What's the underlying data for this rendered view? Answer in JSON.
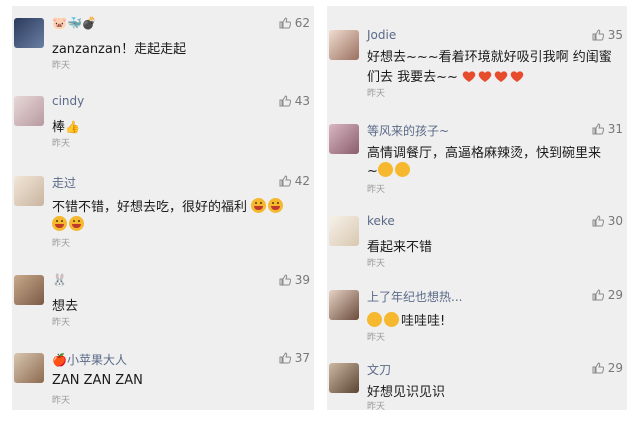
{
  "colors": {
    "panel_bg": "#efefef",
    "name_color": "#5b6a88",
    "time_color": "#9a9a9a",
    "emoji_yellow": "#f5b82e",
    "heart_red": "#e74c2c"
  },
  "left_comments": [
    {
      "name": "",
      "name_icons": [
        "pig-icon",
        "whale-icon",
        "bomb-icon"
      ],
      "text": "zanzanzan！走起走起",
      "time": "昨天",
      "likes": "62"
    },
    {
      "name": "cindy",
      "text": "棒",
      "time": "昨天",
      "likes": "43"
    },
    {
      "name": "走过",
      "text": "不错不错，好想去吃，很好的福利",
      "time": "昨天",
      "likes": "42"
    },
    {
      "name": "",
      "name_icons": [
        "rabbit-icon"
      ],
      "text": "想去",
      "time": "昨天",
      "likes": "39"
    },
    {
      "name": "小苹果大人",
      "text": "ZAN ZAN ZAN",
      "time": "昨天",
      "likes": "37"
    }
  ],
  "right_comments": [
    {
      "name": "Jodie",
      "text_line1": "好想去~~~看着环境就好吸引我啊 约闺蜜",
      "text_line2": "们去 我要去~~",
      "time": "昨天",
      "likes": "35"
    },
    {
      "name": "等风来的孩子~",
      "text_line1": "高情调餐厅，高逼格麻辣烫，快到碗里来",
      "text_line2": "~",
      "time": "昨天",
      "likes": "31"
    },
    {
      "name": "keke",
      "text": "看起来不错",
      "time": "昨天",
      "likes": "30"
    },
    {
      "name": "上了年纪也想热...",
      "text": "哇哇哇!",
      "time": "昨天",
      "likes": "29"
    },
    {
      "name": "文刀",
      "text": "好想见识见识",
      "time": "昨天",
      "likes": "29"
    }
  ]
}
